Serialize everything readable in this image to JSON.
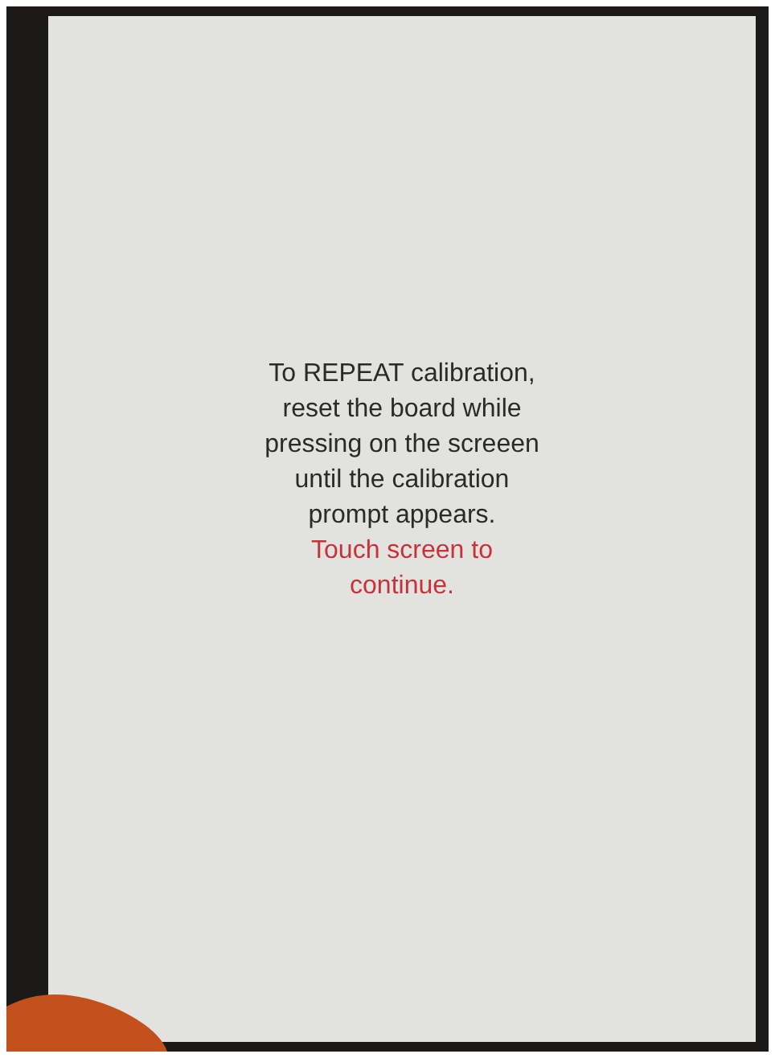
{
  "screen": {
    "instruction_lines": [
      "To REPEAT calibration,",
      "reset the board while",
      "pressing on the screeen",
      "until the calibration",
      "prompt appears."
    ],
    "prompt_lines": [
      "Touch screen to",
      "continue."
    ]
  }
}
